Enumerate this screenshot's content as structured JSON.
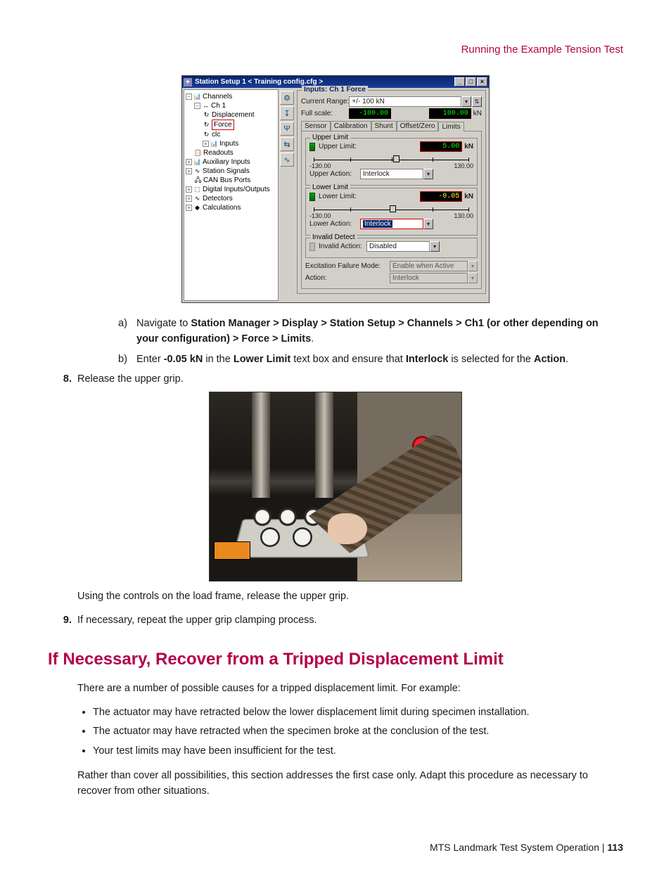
{
  "header": {
    "running": "Running the Example Tension Test"
  },
  "window": {
    "title": "Station Setup 1 < Training config.cfg >",
    "winbtns": {
      "min": "_",
      "max": "□",
      "close": "×"
    },
    "tree": {
      "channels": "Channels",
      "ch1": "Ch 1",
      "displacement": "Displacement",
      "force": "Force",
      "clc": "clc",
      "inputs": "Inputs",
      "readouts": "Readouts",
      "aux": "Auxiliary Inputs",
      "stationsig": "Station Signals",
      "canbus": "CAN Bus Ports",
      "digital": "Digital Inputs/Outputs",
      "detectors": "Detectors",
      "calc": "Calculations"
    },
    "panel": {
      "legend": "Inputs: Ch 1 Force",
      "currentRangeLabel": "Current Range:",
      "currentRange": "+/- 100 kN",
      "fullScaleLabel": "Full scale:",
      "fullLow": "-100.00",
      "fullHigh": "100.00",
      "fullUnit": "kN",
      "tabs": {
        "sensor": "Sensor",
        "cal": "Calibration",
        "shunt": "Shunt",
        "offset": "Offset/Zero",
        "limits": "Limits"
      },
      "upper": {
        "legend": "Upper Limit",
        "label": "Upper Limit:",
        "value": "5.00",
        "unit": "kN",
        "min": "-130.00",
        "max": "130.00",
        "actionLabel": "Upper Action:",
        "action": "Interlock"
      },
      "lower": {
        "legend": "Lower Limit",
        "label": "Lower Limit:",
        "value": "-0.05",
        "unit": "kN",
        "min": "-130.00",
        "max": "130.00",
        "actionLabel": "Lower Action:",
        "action": "Interlock"
      },
      "invalid": {
        "legend": "Invalid Detect",
        "label": "Invalid Action:",
        "value": "Disabled"
      },
      "excitLabel": "Excitation Failure Mode:",
      "excitValue": "Enable when Active",
      "actionLabel": "Action:",
      "actionValue": "Interlock"
    }
  },
  "steps": {
    "a": {
      "marker": "a)",
      "prefix": "Navigate to ",
      "bold": "Station Manager > Display > Station Setup > Channels > Ch1 (or other depending on your configuration) > Force > Limits",
      "suffix": "."
    },
    "b": {
      "marker": "b)",
      "t1": "Enter ",
      "b1": "-0.05 kN",
      "t2": " in the ",
      "b2": "Lower Limit",
      "t3": " text box and ensure that ",
      "b3": "Interlock",
      "t4": " is selected for the ",
      "b4": "Action",
      "t5": "."
    },
    "s8num": "8.",
    "s8": "Release the upper grip.",
    "s8cap": "Using the controls on the load frame, release the upper grip.",
    "s9num": "9.",
    "s9": "If necessary, repeat the upper grip clamping process."
  },
  "section": {
    "title": "If Necessary, Recover from a Tripped Displacement Limit",
    "intro": "There are a number of possible causes for a tripped displacement limit. For example:",
    "b1": "The actuator may have retracted below the lower displacement limit during specimen installation.",
    "b2": "The actuator may have retracted when the specimen broke at the conclusion of the test.",
    "b3": "Your test limits may have been insufficient for the test.",
    "outro": "Rather than cover all possibilities, this section addresses the first case only. Adapt this procedure as necessary to recover from other situations."
  },
  "footer": {
    "text": "MTS Landmark Test System Operation | ",
    "page": "113"
  }
}
